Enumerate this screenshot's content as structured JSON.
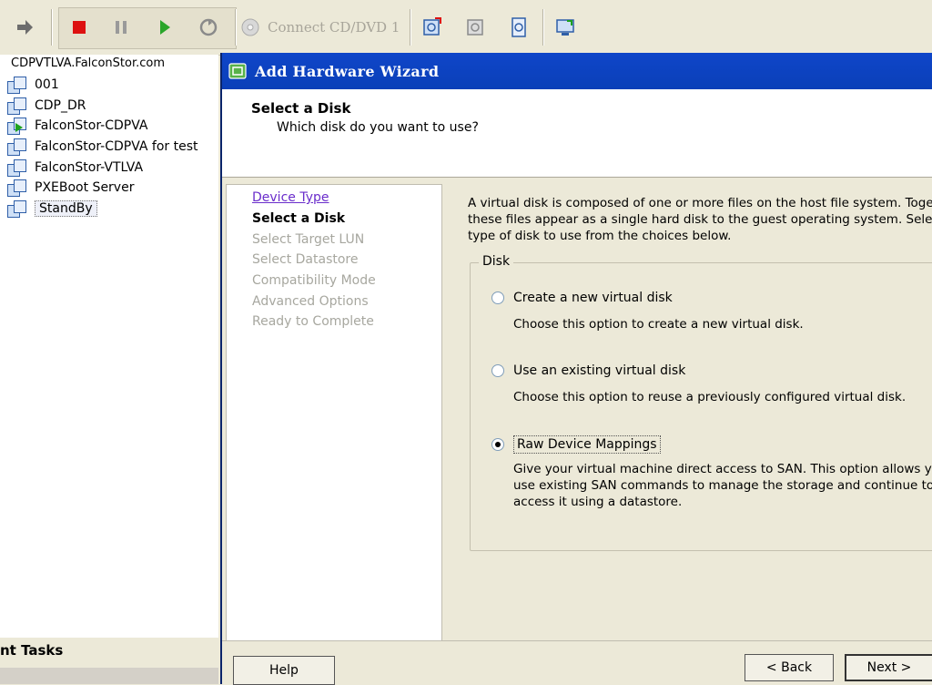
{
  "toolbar": {
    "connect_cd_label": "Connect CD/DVD 1"
  },
  "tree": {
    "host": "CDPVTLVA.FalconStor.com",
    "items": [
      {
        "label": "001"
      },
      {
        "label": "CDP_DR"
      },
      {
        "label": "FalconStor-CDPVA"
      },
      {
        "label": "FalconStor-CDPVA for test"
      },
      {
        "label": "FalconStor-VTLVA"
      },
      {
        "label": "PXEBoot Server"
      },
      {
        "label": "StandBy"
      }
    ],
    "tasks_label": "nt Tasks"
  },
  "wizard": {
    "title": "Add Hardware Wizard",
    "header_title": "Select a Disk",
    "header_subtitle": "Which disk do you want to use?",
    "steps": [
      {
        "label": "Device Type",
        "state": "link"
      },
      {
        "label": "Select a Disk",
        "state": "current"
      },
      {
        "label": "Select Target LUN",
        "state": "disabled"
      },
      {
        "label": "Select Datastore",
        "state": "disabled"
      },
      {
        "label": "Compatibility Mode",
        "state": "disabled"
      },
      {
        "label": "Advanced Options",
        "state": "disabled"
      },
      {
        "label": "Ready to Complete",
        "state": "disabled"
      }
    ],
    "description": [
      "A virtual disk is composed of one or more files on the host file system. Toge",
      "these files appear as a single hard disk to the guest operating system. Sele",
      "type of disk to use from the choices below."
    ],
    "group_label": "Disk",
    "options": [
      {
        "label": "Create a new virtual disk",
        "selected": false,
        "desc": [
          "Choose this option to create a new virtual disk."
        ]
      },
      {
        "label": "Use an existing virtual disk",
        "selected": false,
        "desc": [
          "Choose this option to reuse a previously configured virtual disk."
        ]
      },
      {
        "label": "Raw Device Mappings",
        "selected": true,
        "desc": [
          "Give your virtual machine direct access to SAN. This option allows y",
          "use existing SAN commands to manage the storage and continue to",
          "access it using a datastore."
        ]
      }
    ],
    "buttons": {
      "help": "Help",
      "back": "< Back",
      "next": "Next >"
    }
  }
}
